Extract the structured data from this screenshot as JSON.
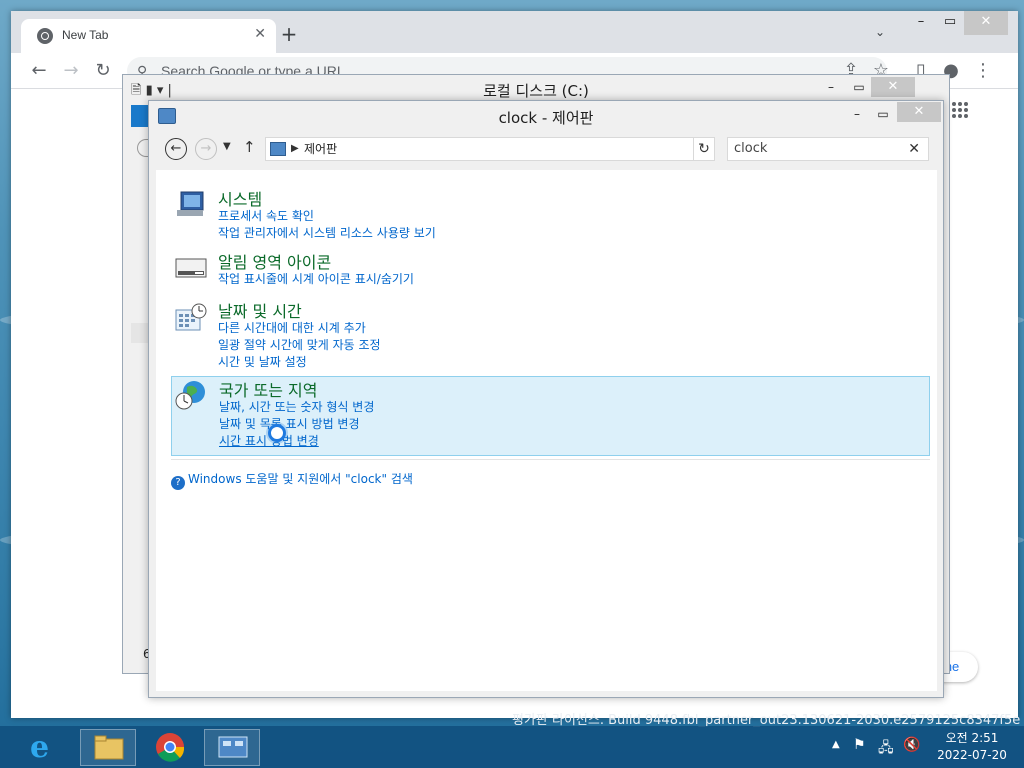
{
  "chrome": {
    "tab_title": "New Tab",
    "omnibox_placeholder": "Search Google or type a URL",
    "customize_label": "ome"
  },
  "explorer": {
    "title": "로컬 디스크 (C:)",
    "bottom_number": "6"
  },
  "control_panel": {
    "title": "clock - 제어판",
    "address": "제어판",
    "search_value": "clock",
    "groups": [
      {
        "title": "시스템",
        "links": [
          "프로세서 속도 확인",
          "작업 관리자에서 시스템 리소스 사용량 보기"
        ]
      },
      {
        "title": "알림 영역 아이콘",
        "links": [
          "작업 표시줄에 시계 아이콘 표시/숨기기"
        ]
      },
      {
        "title": "날짜 및 시간",
        "links": [
          "다른 시간대에 대한 시계 추가",
          "일광 절약 시간에 맞게 자동 조정",
          "시간 및 날짜 설정"
        ]
      },
      {
        "title": "국가 또는 지역",
        "links": [
          "날짜, 시간 또는 숫자 형식 변경",
          "날짜 및 목록 표시 방법 변경",
          "시간 표시 방법 변경"
        ]
      }
    ],
    "help_text": "Windows 도움말 및 지원에서 \"clock\" 검색"
  },
  "desktop": {
    "build_text": "평가판 라이선스. Build 9448.fbl_partner_out23.130621-2030.e2579125c8347f5e"
  },
  "taskbar": {
    "time": "오전 2:51",
    "date": "2022-07-20"
  },
  "colors": {
    "link": "#0066cc",
    "group_title": "#0b6a2a",
    "highlight_bg": "#dcf0fa",
    "highlight_border": "#8fd0ed"
  }
}
